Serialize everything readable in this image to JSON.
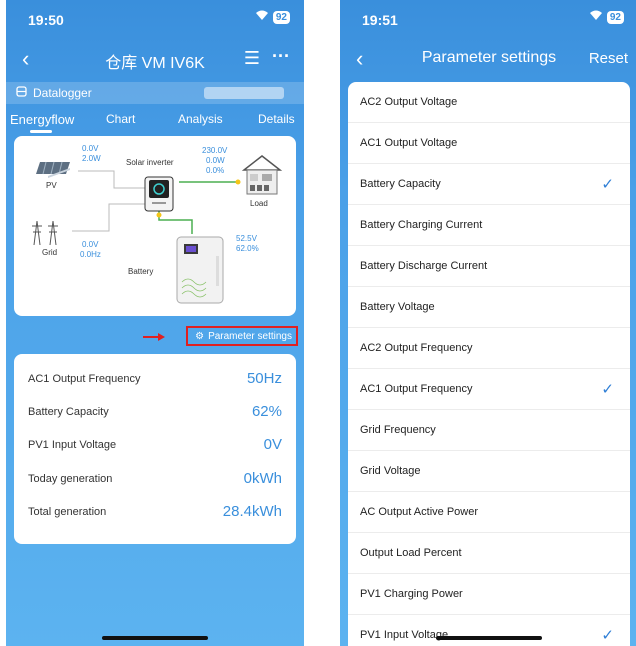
{
  "left": {
    "status": {
      "time": "19:50",
      "battery": "92"
    },
    "nav": {
      "title": "仓库 VM IV6K"
    },
    "datalogger": {
      "label": "Datalogger"
    },
    "tabs": [
      "Energyflow",
      "Chart",
      "Analysis",
      "Details"
    ],
    "flow": {
      "pv_label": "PV",
      "pv_voltage": "0.0V",
      "pv_power": "2.0W",
      "inverter_label": "Solar inverter",
      "load_voltage": "230.0V",
      "load_power": "0.0W",
      "load_percent": "0.0%",
      "load_label": "Load",
      "grid_label": "Grid",
      "grid_voltage": "0.0V",
      "grid_freq": "0.0Hz",
      "battery_label": "Battery",
      "battery_voltage": "52.5V",
      "battery_percent": "62.0%"
    },
    "param_settings_label": "Parameter settings",
    "stats": [
      {
        "label": "AC1 Output Frequency",
        "value": "50Hz"
      },
      {
        "label": "Battery Capacity",
        "value": "62%"
      },
      {
        "label": "PV1 Input Voltage",
        "value": "0V"
      },
      {
        "label": "Today generation",
        "value": "0kWh"
      },
      {
        "label": "Total generation",
        "value": "28.4kWh"
      }
    ]
  },
  "right": {
    "status": {
      "time": "19:51",
      "battery": "92"
    },
    "nav": {
      "title": "Parameter settings",
      "reset": "Reset"
    },
    "items": [
      {
        "label": "AC2 Output Voltage",
        "checked": false
      },
      {
        "label": "AC1 Output Voltage",
        "checked": false
      },
      {
        "label": "Battery Capacity",
        "checked": true
      },
      {
        "label": "Battery Charging Current",
        "checked": false
      },
      {
        "label": "Battery Discharge Current",
        "checked": false
      },
      {
        "label": "Battery Voltage",
        "checked": false
      },
      {
        "label": "AC2 Output Frequency",
        "checked": false
      },
      {
        "label": "AC1 Output Frequency",
        "checked": true
      },
      {
        "label": "Grid Frequency",
        "checked": false
      },
      {
        "label": "Grid Voltage",
        "checked": false
      },
      {
        "label": "AC Output Active Power",
        "checked": false
      },
      {
        "label": "Output Load Percent",
        "checked": false
      },
      {
        "label": "PV1 Charging Power",
        "checked": false
      },
      {
        "label": "PV1 Input Voltage",
        "checked": true
      }
    ]
  },
  "colors": {
    "accent": "#3a8fdc",
    "check": "#2f7fd6",
    "highlight": "#e02020"
  }
}
